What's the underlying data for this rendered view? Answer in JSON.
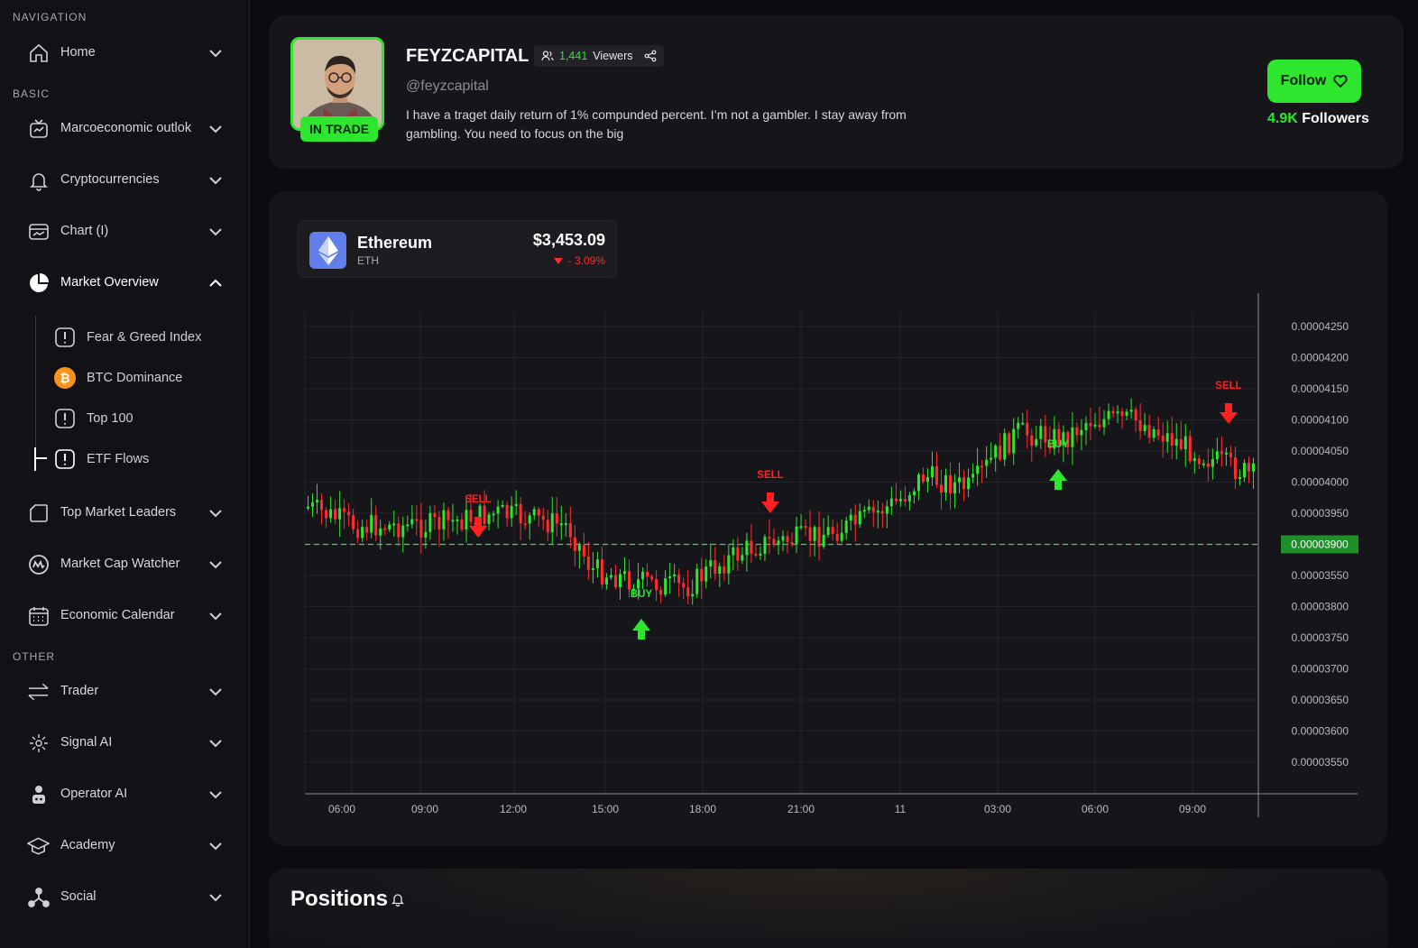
{
  "sidebar": {
    "sections": {
      "navigation": "NAVIGATION",
      "basic": "BASIC",
      "other": "OTHER"
    },
    "home": {
      "label": "Home",
      "icon": "home-icon"
    },
    "basic_items": [
      {
        "label": "Marcoeconomic outlok",
        "icon": "tv-icon"
      },
      {
        "label": "Cryptocurrencies",
        "icon": "bell-icon"
      },
      {
        "label": "Chart (I)",
        "icon": "chart-window-icon"
      },
      {
        "label": "Market Overview",
        "icon": "pie-chart-icon",
        "expanded": true
      }
    ],
    "market_overview_sub": [
      {
        "label": "Fear & Greed Index",
        "icon": "alert-icon"
      },
      {
        "label": "BTC Dominance",
        "icon": "bitcoin-icon"
      },
      {
        "label": "Top 100",
        "icon": "alert-icon"
      },
      {
        "label": "ETF Flows",
        "icon": "alert-icon"
      }
    ],
    "basic_items_2": [
      {
        "label": "Top Market Leaders",
        "icon": "bag-icon"
      },
      {
        "label": "Market Cap Watcher",
        "icon": "coinmarketcap-icon"
      },
      {
        "label": "Economic Calendar",
        "icon": "calendar-icon"
      }
    ],
    "other_items": [
      {
        "label": "Trader",
        "icon": "swap-icon"
      },
      {
        "label": "Signal AI",
        "icon": "signal-icon"
      },
      {
        "label": "Operator AI",
        "icon": "robot-icon"
      },
      {
        "label": "Academy",
        "icon": "graduation-cap-icon"
      },
      {
        "label": "Social",
        "icon": "network-icon"
      }
    ]
  },
  "profile": {
    "name": "FEYZCAPITAL",
    "viewers_count": "1,441",
    "viewers_label": "Viewers",
    "handle": "@feyzcapital",
    "bio": "I have a traget daily return of 1% compunded percent. I’m not a gambler. I stay away from gambling. You need to focus on the big",
    "status_badge": "IN TRADE",
    "follow_label": "Follow",
    "followers_count": "4.9K",
    "followers_label": "Followers"
  },
  "ticker": {
    "name": "Ethereum",
    "symbol": "ETH",
    "price": "$3,453.09",
    "change": "- 3.09%",
    "colors": {
      "up": "#2ee62e",
      "down": "#ff2d2d",
      "accent": "#2ee62e"
    }
  },
  "chart_data": {
    "type": "candlestick",
    "x_tick_labels": [
      "06:00",
      "09:00",
      "12:00",
      "15:00",
      "18:00",
      "21:00",
      "11",
      "03:00",
      "06:00",
      "09:00"
    ],
    "y_tick_labels": [
      "0.00004250",
      "0.00004200",
      "0.00004150",
      "0.00004100",
      "0.00004050",
      "0.00004000",
      "0.00003950",
      "0.00003900",
      "0.00003550",
      "0.00003800",
      "0.00003750",
      "0.00003700",
      "0.00003650",
      "0.00003600",
      "0.00003550"
    ],
    "current_price_label": "0.00003900",
    "grid": true,
    "signals": [
      {
        "type": "SELL",
        "near": "11:00"
      },
      {
        "type": "BUY",
        "near": "16:00"
      },
      {
        "type": "SELL",
        "near": "20:00"
      },
      {
        "type": "BUY",
        "near": "05:00"
      },
      {
        "type": "SELL",
        "near": "09:30"
      }
    ],
    "price_path": [
      [
        0,
        3.96e-05
      ],
      [
        2,
        3.93e-05
      ],
      [
        5,
        3.93e-05
      ],
      [
        8,
        3.95e-05
      ],
      [
        11,
        3.93e-05
      ],
      [
        12,
        3.86e-05
      ],
      [
        14,
        3.84e-05
      ],
      [
        16,
        3.83e-05
      ],
      [
        17,
        3.86e-05
      ],
      [
        19,
        3.9e-05
      ],
      [
        21,
        3.91e-05
      ],
      [
        23,
        3.93e-05
      ],
      [
        25,
        3.97e-05
      ],
      [
        26,
        4.01e-05
      ],
      [
        28,
        3.99e-05
      ],
      [
        29,
        4.04e-05
      ],
      [
        30,
        4.08e-05
      ],
      [
        32,
        4.07e-05
      ],
      [
        33,
        4.1e-05
      ],
      [
        35,
        4.1e-05
      ],
      [
        37,
        4.06e-05
      ],
      [
        38,
        4.04e-05
      ],
      [
        40,
        4.01e-05
      ]
    ]
  },
  "positions": {
    "title": "Positions"
  }
}
